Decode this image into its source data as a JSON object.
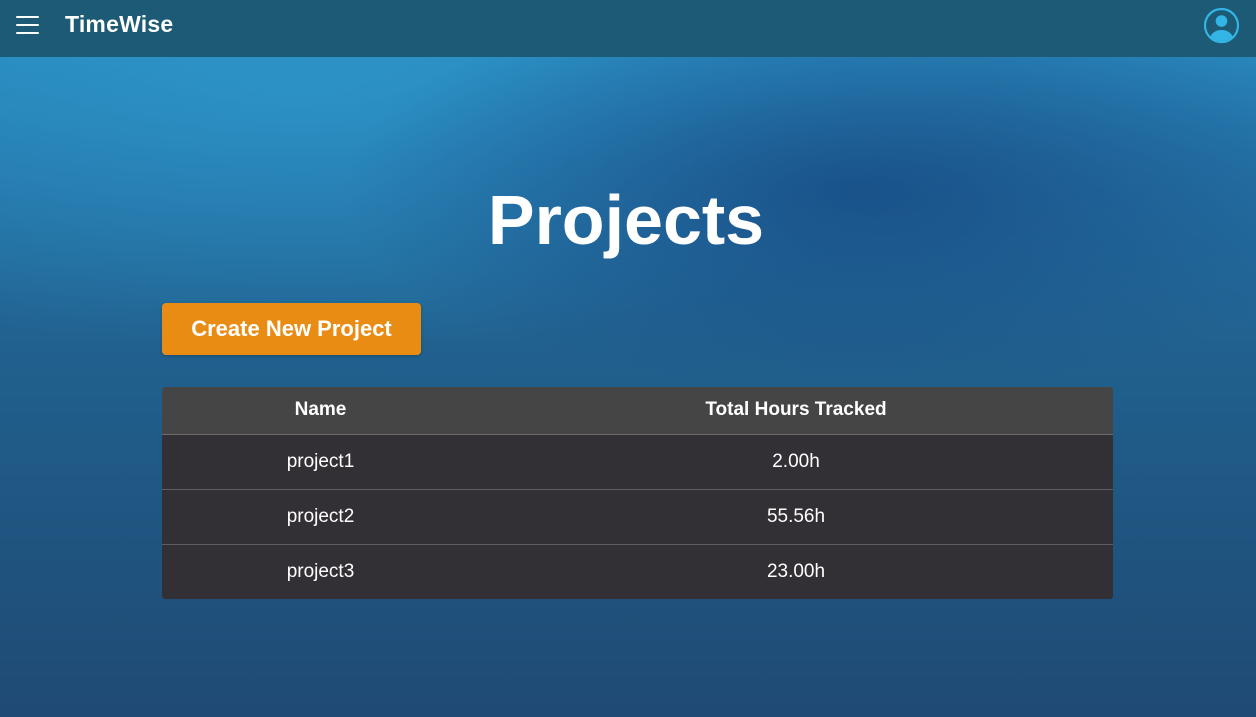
{
  "app": {
    "title": "TimeWise"
  },
  "header": {
    "menu_icon": "hamburger-menu-icon",
    "profile_icon": "user-circle-icon"
  },
  "main": {
    "title": "Projects",
    "create_button_label": "Create New Project",
    "table": {
      "columns": [
        "Name",
        "Total Hours Tracked"
      ],
      "rows": [
        {
          "name": "project1",
          "hours": "2.00h"
        },
        {
          "name": "project2",
          "hours": "55.56h"
        },
        {
          "name": "project3",
          "hours": "23.00h"
        }
      ]
    }
  },
  "colors": {
    "topbar": "#1d5a76",
    "accent_button": "#e98c14",
    "profile_icon": "#33b5e5",
    "table_header": "#464545",
    "table_row": "#322f35"
  }
}
